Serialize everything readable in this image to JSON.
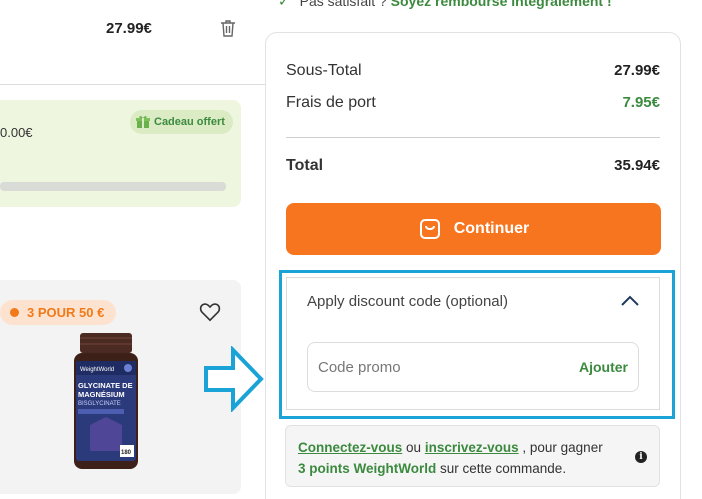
{
  "guarantee": {
    "text_prefix": "Pas satisfait ?",
    "text_green": "Soyez remboursé intégralement !"
  },
  "cart_item": {
    "price": "27.99€",
    "delete_icon": "trash-icon"
  },
  "gift_progress": {
    "amount": "0.00€",
    "badge_label": "Cadeau offert",
    "badge_icon": "gift-icon",
    "progress": 0
  },
  "product_card": {
    "promo_label": "3 POUR 50 €",
    "wishlist_icon": "heart-icon",
    "bottle_brand": "WeightWorld",
    "bottle_line1": "GLYCINATE DE",
    "bottle_line2": "MAGNÉSIUM",
    "bottle_line3": "BISGLYCINATE",
    "bottle_count": "180"
  },
  "summary": {
    "subtotal_label": "Sous-Total",
    "subtotal_value": "27.99€",
    "shipping_label": "Frais de port",
    "shipping_value": "7.95€",
    "total_label": "Total",
    "total_value": "35.94€",
    "continue_label": "Continuer",
    "continue_icon": "cart-bag-icon"
  },
  "discount": {
    "header_label": "Apply discount code (optional)",
    "toggle_icon": "chevron-up-icon",
    "input_placeholder": "Code promo",
    "input_value": "",
    "apply_label": "Ajouter"
  },
  "points": {
    "login_link": "Connectez-vous",
    "or_text": "ou",
    "signup_link": "inscrivez-vous",
    "middle_text": ", pour gagner",
    "points_text": "3 points WeightWorld",
    "end_text": "sur cette commande.",
    "info_icon": "info-icon"
  },
  "colors": {
    "accent_orange": "#f7751f",
    "green": "#3b8a3e",
    "highlight_blue": "#1aa3d6"
  }
}
